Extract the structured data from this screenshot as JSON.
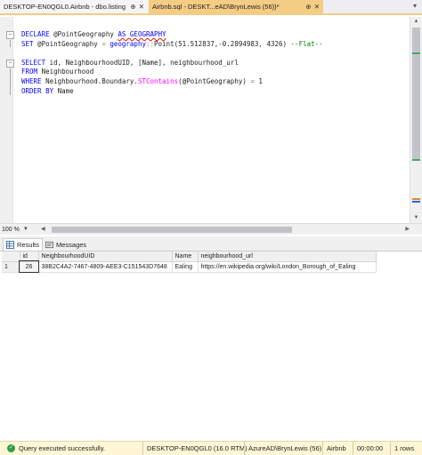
{
  "tabs": [
    {
      "title": "DESKTOP-EN0QGL0.Airbnb - dbo.listing",
      "pin": "⊕",
      "close": "✕"
    },
    {
      "title": "Airbnb.sql - DESKT...eAD\\BrynLewis (56))*",
      "pin": "⊕",
      "close": "✕"
    }
  ],
  "tab_overflow": "▾",
  "code": {
    "l1_kw": "DECLARE",
    "l1_rest": " @PointGeography ",
    "l1_as": "AS GEOGRAPHY",
    "l2_kw": "SET",
    "l2_var": " @PointGeography ",
    "l2_eq": "=",
    "l2_geo": " geography",
    "l2_colons": "::",
    "l2_point": "Point",
    "l2_args": "(51.512837,-0.2894983, 4326)",
    "l2_cm": " --Flat--",
    "l4_kw": "SELECT",
    "l4_rest": " id, NeighbourhoodUID, [Name], neighbourhood_url",
    "l5_kw": "FROM",
    "l5_rest": " Neighbourhood",
    "l6_kw": "WHERE",
    "l6_rest": " Neighbourhood.Boundary.",
    "l6_fn": "STContains",
    "l6_args": "(@PointGeography) ",
    "l6_eq": "=",
    "l6_val": " 1",
    "l7_kw": "ORDER BY",
    "l7_rest": " Name"
  },
  "zoom": "100 %",
  "result_tabs": {
    "results": "Results",
    "messages": "Messages"
  },
  "grid": {
    "columns": [
      "id",
      "NeighbourhoodUID",
      "Name",
      "neighbourhood_url"
    ],
    "rows": [
      {
        "num": "1",
        "id": "26",
        "uid": "38B2C4A2-7467-4809-AEE3-C151543D7648",
        "name": "Ealing",
        "url": "https://en.wikipedia.org/wiki/London_Borough_of_Ealing"
      }
    ]
  },
  "status": {
    "message": "Query executed successfully.",
    "server": "DESKTOP-EN0QGL0 (16.0 RTM)",
    "user": "AzureAD\\BrynLewis (56)",
    "database": "Airbnb",
    "time": "00:00:00",
    "rows": "1 rows"
  },
  "colors": {
    "tab_active": "#f5cc84",
    "status_bg": "#fff6d6",
    "keyword": "#0000ff",
    "comment": "#008000",
    "function": "#ff00ff"
  }
}
